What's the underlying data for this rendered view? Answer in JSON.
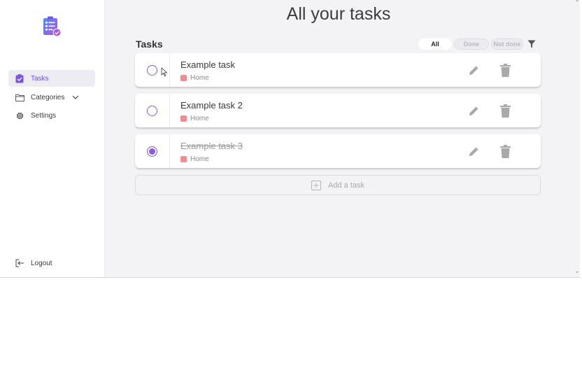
{
  "sidebar": {
    "items": [
      {
        "label": "Tasks",
        "icon": "clipboard-check-icon",
        "active": true
      },
      {
        "label": "Categories",
        "icon": "folder-icon",
        "active": false
      },
      {
        "label": "Settings",
        "icon": "gear-icon",
        "active": false
      }
    ],
    "logout_label": "Logout",
    "logo_icon": "clipboard-logo-icon"
  },
  "main": {
    "title": "All your tasks",
    "section_title": "Tasks",
    "filters": {
      "all_label": "All",
      "done_label": "Done",
      "not_done_label": "Not done",
      "selected": "All",
      "icon": "filter-icon"
    },
    "tasks": [
      {
        "name": "Example task",
        "category": "Home",
        "done": false
      },
      {
        "name": "Example task 2",
        "category": "Home",
        "done": false
      },
      {
        "name": "Example task 3",
        "category": "Home",
        "done": true
      }
    ],
    "add_task_label": "Add a task"
  },
  "colors": {
    "accent": "#8d5ae0",
    "category_home": "#f28a92",
    "background": "#f3f3f6"
  }
}
